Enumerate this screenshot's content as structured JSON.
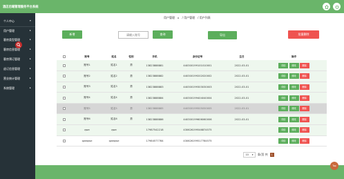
{
  "header": {
    "title": "酒店后端管理服务平台系统",
    "buttons": [
      {
        "icon": "home-icon"
      },
      {
        "icon": "logout-icon"
      }
    ]
  },
  "sidebar": {
    "items": [
      {
        "label": "个人中心",
        "chevron": "▾"
      },
      {
        "label": "用户管理",
        "chevron": "▸"
      },
      {
        "label": "客房类型管理",
        "chevron": "▸"
      },
      {
        "label": "客房信息管理",
        "chevron": "▸"
      },
      {
        "label": "客房预订管理",
        "chevron": "▸"
      },
      {
        "label": "退订信息管理",
        "chevron": "▸"
      },
      {
        "label": "营业统计管理",
        "chevron": "▸"
      },
      {
        "label": "系统管理",
        "chevron": "▸"
      }
    ]
  },
  "breadcrumb": [
    "用户管理",
    "⌂",
    "/ 用户管理",
    "/ 用户列表"
  ],
  "toolbar": {
    "add_label": "新增",
    "search_placeholder": "请输入账号",
    "search_label": "查询",
    "export_label": "导出",
    "batch_delete_label": "批量删除"
  },
  "table": {
    "columns": [
      "",
      "账号",
      "姓名",
      "性别",
      "手机",
      "身份证号",
      "生日",
      "操作"
    ],
    "rows": [
      {
        "account": "账号1",
        "name": "姓名1",
        "gender": "男",
        "phone": "13823888881",
        "id_card": "440300199101010001",
        "birthday": "2022-03-01",
        "style": "alt"
      },
      {
        "account": "账号2",
        "name": "姓名2",
        "gender": "男",
        "phone": "13823888882",
        "id_card": "440300199202020002",
        "birthday": "2022-03-01",
        "style": "alt"
      },
      {
        "account": "账号3",
        "name": "姓名3",
        "gender": "男",
        "phone": "13823888883",
        "id_card": "440300199303030003",
        "birthday": "2022-03-01",
        "style": "alt"
      },
      {
        "account": "账号4",
        "name": "姓名4",
        "gender": "男",
        "phone": "13823888884",
        "id_card": "440300199404040004",
        "birthday": "2022-03-01",
        "style": "alt"
      },
      {
        "account": "账号5",
        "name": "姓名5",
        "gender": "男",
        "phone": "13823888885",
        "id_card": "440300199505050005",
        "birthday": "2022-03-01",
        "style": "hl"
      },
      {
        "account": "账号6",
        "name": "姓名6",
        "gender": "男",
        "phone": "13823888886",
        "id_card": "440300199606060006",
        "birthday": "2022-03-01",
        "style": "alt"
      },
      {
        "account": "qwe",
        "name": "qwe",
        "gender": "",
        "phone": "17987542218",
        "id_card": "430626199546874575",
        "birthday": "",
        "style": "alt"
      },
      {
        "account": "qweqwe",
        "name": "qweqwe",
        "gender": "",
        "phone": "17984577784",
        "id_card": "430626199517784575",
        "birthday": "",
        "style": "plain"
      }
    ],
    "actions": {
      "detail": "详情",
      "edit": "修改",
      "delete": "删除"
    }
  },
  "pagination": {
    "page_size": "10",
    "caret": "▾",
    "goto_label": "条/页 共",
    "current_page": "1"
  },
  "back_to_top_label": "Top",
  "colors": {
    "primary_green": "#6ab56a",
    "sidebar_bg": "#263238",
    "danger_red": "#ef5350",
    "highlight_row": "#d6d6d6"
  }
}
